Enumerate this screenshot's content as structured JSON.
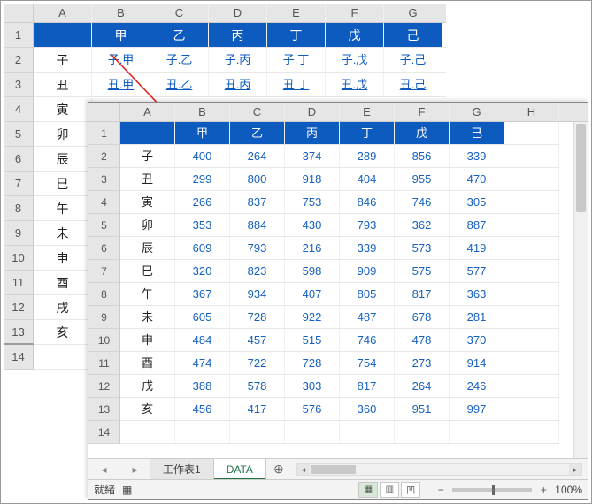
{
  "back": {
    "cols": [
      "A",
      "B",
      "C",
      "D",
      "E",
      "F",
      "G"
    ],
    "row_headers": [
      "1",
      "2",
      "3",
      "4",
      "5",
      "6",
      "7",
      "8",
      "9",
      "10",
      "11",
      "12",
      "13",
      "14"
    ],
    "header_cells": [
      "",
      "甲",
      "乙",
      "丙",
      "丁",
      "戊",
      "己"
    ],
    "rows": [
      [
        "子",
        "子.甲",
        "子.乙",
        "子.丙",
        "子.丁",
        "子.戊",
        "子.己"
      ],
      [
        "丑",
        "丑.甲",
        "丑.乙",
        "丑.丙",
        "丑.丁",
        "丑.戊",
        "丑.己"
      ]
    ],
    "labels_rest": [
      "寅",
      "卯",
      "辰",
      "巳",
      "午",
      "未",
      "申",
      "酉",
      "戌",
      "亥"
    ]
  },
  "front": {
    "cols": [
      "A",
      "B",
      "C",
      "D",
      "E",
      "F",
      "G",
      "H"
    ],
    "row_headers": [
      "1",
      "2",
      "3",
      "4",
      "5",
      "6",
      "7",
      "8",
      "9",
      "10",
      "11",
      "12",
      "13",
      "14"
    ],
    "header_cells": [
      "",
      "甲",
      "乙",
      "丙",
      "丁",
      "戊",
      "己"
    ]
  },
  "chart_data": {
    "type": "table",
    "title": "DATA",
    "columns": [
      "",
      "甲",
      "乙",
      "丙",
      "丁",
      "戊",
      "己"
    ],
    "rows": [
      {
        "label": "子",
        "values": [
          400,
          264,
          374,
          289,
          856,
          339
        ]
      },
      {
        "label": "丑",
        "values": [
          299,
          800,
          918,
          404,
          955,
          470
        ]
      },
      {
        "label": "寅",
        "values": [
          266,
          837,
          753,
          846,
          746,
          305
        ]
      },
      {
        "label": "卯",
        "values": [
          353,
          884,
          430,
          793,
          362,
          887
        ]
      },
      {
        "label": "辰",
        "values": [
          609,
          793,
          216,
          339,
          573,
          419
        ]
      },
      {
        "label": "巳",
        "values": [
          320,
          823,
          598,
          909,
          575,
          577
        ]
      },
      {
        "label": "午",
        "values": [
          367,
          934,
          407,
          805,
          817,
          363
        ]
      },
      {
        "label": "未",
        "values": [
          605,
          728,
          922,
          487,
          678,
          281
        ]
      },
      {
        "label": "申",
        "values": [
          484,
          457,
          515,
          746,
          478,
          370
        ]
      },
      {
        "label": "酉",
        "values": [
          474,
          722,
          728,
          754,
          273,
          914
        ]
      },
      {
        "label": "戌",
        "values": [
          388,
          578,
          303,
          817,
          264,
          246
        ]
      },
      {
        "label": "亥",
        "values": [
          456,
          417,
          576,
          360,
          951,
          997
        ]
      }
    ]
  },
  "tabs": {
    "t1": "工作表1",
    "t2": "DATA",
    "add": "⊕"
  },
  "status": {
    "ready": "就緒",
    "record_icon": "▦",
    "zoom": "100%",
    "minus": "−",
    "plus": "+"
  },
  "viewbtn": {
    "normal": "▦",
    "layout": "▥",
    "break": "凹"
  }
}
